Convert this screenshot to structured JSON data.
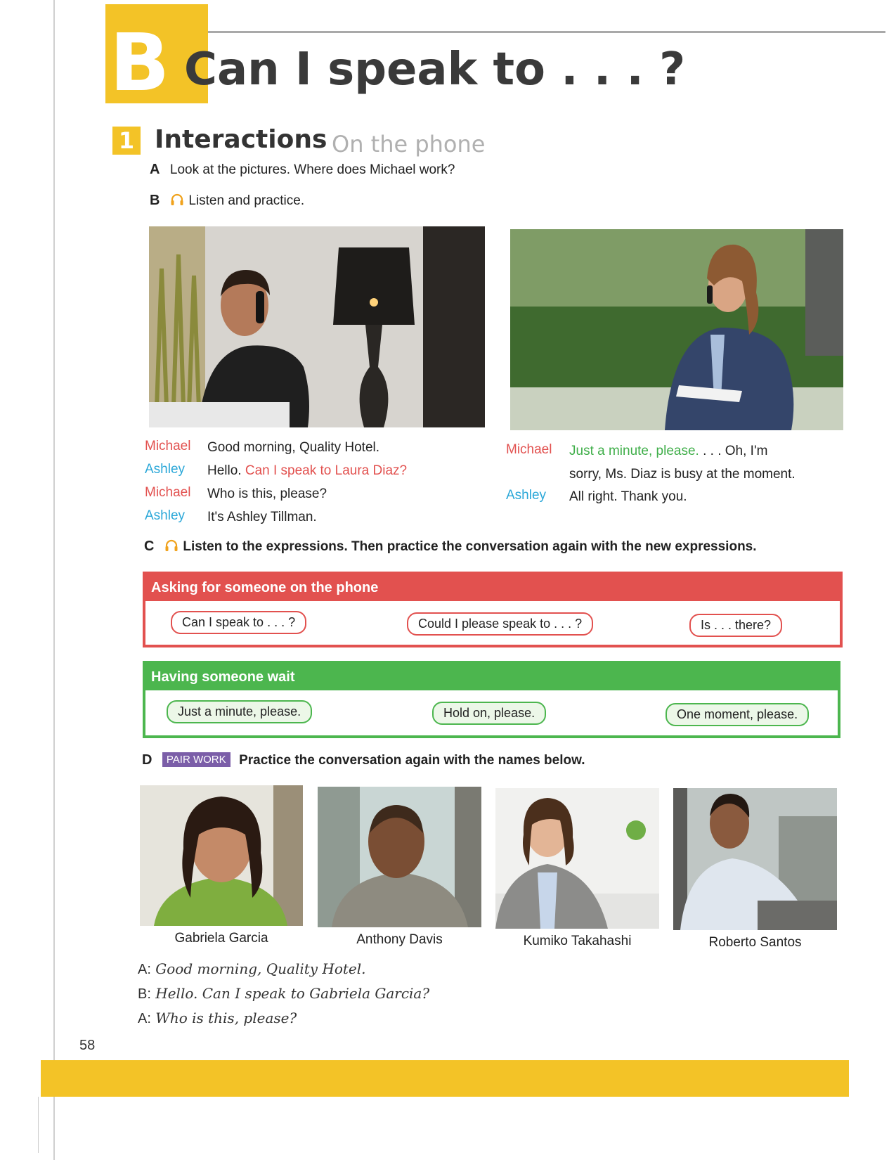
{
  "lesson": {
    "letter": "B",
    "title": "Can I speak to . . . ?"
  },
  "section": {
    "number": "1",
    "title": "Interactions",
    "subtitle": "On the phone"
  },
  "tasks": {
    "a": {
      "letter": "A",
      "text": "Look at the pictures. Where does Michael work?"
    },
    "b": {
      "letter": "B",
      "text": "Listen and practice."
    },
    "c": {
      "letter": "C",
      "text": "Listen to the expressions. Then practice the conversation again with the new expressions."
    },
    "d": {
      "letter": "D",
      "badge": "PAIR WORK",
      "text": "Practice the conversation again with the names below."
    }
  },
  "conversation": {
    "left": [
      {
        "speaker": "Michael",
        "plain": "Good morning, Quality Hotel.",
        "highlight": ""
      },
      {
        "speaker": "Ashley",
        "plain": "Hello. ",
        "highlight": "Can I speak to Laura Diaz?"
      },
      {
        "speaker": "Michael",
        "plain": "Who is this, please?",
        "highlight": ""
      },
      {
        "speaker": "Ashley",
        "plain": "It's Ashley Tillman.",
        "highlight": ""
      }
    ],
    "right": [
      {
        "speaker": "Michael",
        "highlight": "Just a minute, please.",
        "plain": " . . . Oh, I'm",
        "line2": "sorry, Ms. Diaz is busy at the moment."
      },
      {
        "speaker": "Ashley",
        "plain": "All right. Thank you."
      }
    ]
  },
  "boxes": {
    "asking": {
      "title": "Asking for someone on the phone",
      "expressions": [
        "Can I speak to . . . ?",
        "Could I please speak to . . . ?",
        "Is . . . there?"
      ]
    },
    "waiting": {
      "title": "Having someone wait",
      "expressions": [
        "Just a minute, please.",
        "Hold on, please.",
        "One moment, please."
      ]
    }
  },
  "people": [
    "Gabriela Garcia",
    "Anthony Davis",
    "Kumiko Takahashi",
    "Roberto Santos"
  ],
  "model_dialog": [
    {
      "speaker": "A:",
      "text": "Good morning, Quality Hotel."
    },
    {
      "speaker": "B:",
      "text": "Hello. Can I speak to Gabriela Garcia?"
    },
    {
      "speaker": "A:",
      "text": "Who is this, please?"
    }
  ],
  "page_number": "58",
  "colors": {
    "yellow": "#f3c327",
    "red": "#e2514f",
    "green": "#4cb64e",
    "blue": "#2aa7d8",
    "purple": "#7b5ea8"
  }
}
